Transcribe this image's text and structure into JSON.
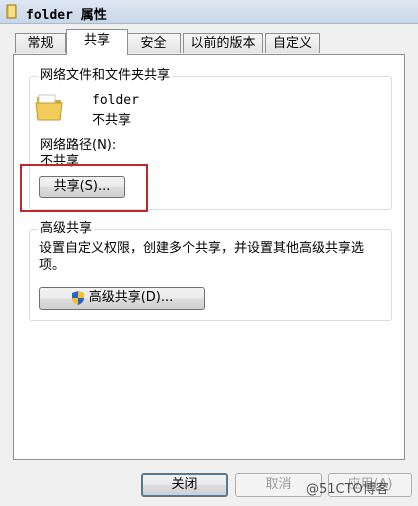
{
  "window": {
    "title": "folder 属性"
  },
  "tabs": [
    {
      "label": "常规"
    },
    {
      "label": "共享"
    },
    {
      "label": "安全"
    },
    {
      "label": "以前的版本"
    },
    {
      "label": "自定义"
    }
  ],
  "network_sharing": {
    "group_label": "网络文件和文件夹共享",
    "folder_name": "folder",
    "share_status": "不共享",
    "path_label": "网络路径(N):",
    "path_value": "不共享",
    "share_button": "共享(S)..."
  },
  "advanced_sharing": {
    "group_label": "高级共享",
    "description": "设置自定义权限，创建多个共享，并设置其他高级共享选项。",
    "button": "高级共享(D)..."
  },
  "footer": {
    "close_button": "关闭",
    "cancel_button": "取消",
    "apply_button": "应用(A)"
  },
  "watermark": "@51CTO博客",
  "icons": {
    "title": "folder-icon",
    "folder": "folder-icon",
    "shield": "uac-shield-icon"
  }
}
